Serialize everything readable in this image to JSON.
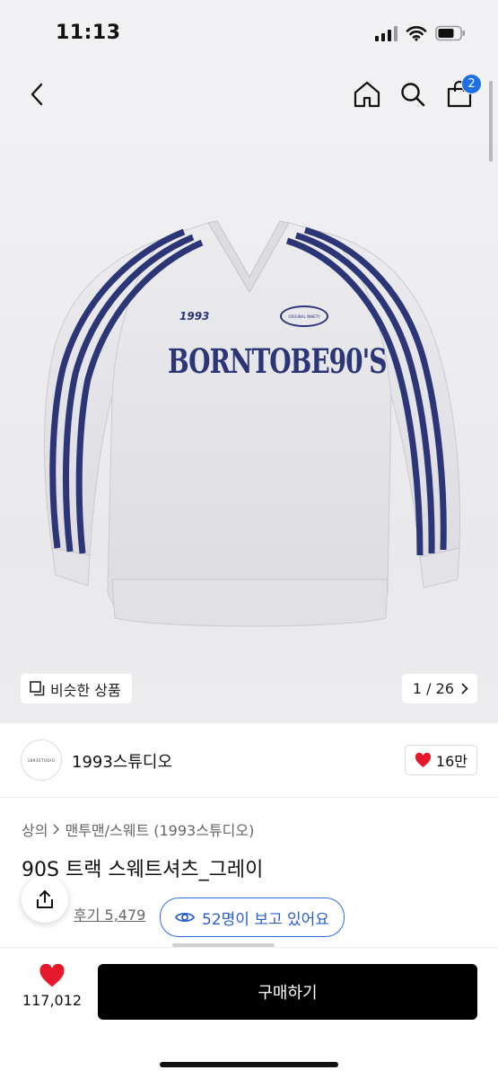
{
  "status_bar": {
    "time": "11:13"
  },
  "nav": {
    "cart_count": "2",
    "back_icon": "chevron-left-icon",
    "home_icon": "home-icon",
    "search_icon": "search-icon",
    "cart_icon": "shopping-bag-icon"
  },
  "gallery": {
    "similar_label": "비슷한 상품",
    "page_counter": "1 / 26",
    "print_text": "BORNTOBE90'S",
    "chest_logo": "1993",
    "badge_text": "ORIGINAL NINETY",
    "colors": {
      "body": "#e6e6e9",
      "stripe": "#2c3575"
    }
  },
  "brand": {
    "name": "1993스튜디오",
    "logo_text": "1993STUDIO",
    "likes": "16만"
  },
  "product": {
    "breadcrumb": [
      "상의",
      "맨투맨/스웨트 (1993스튜디오)"
    ],
    "title": "90S 트랙 스웨트셔츠_그레이",
    "review_text": "후기 5,479",
    "viewers_text": "52명이 보고 있어요"
  },
  "bottom": {
    "favorite_count": "117,012",
    "buy_label": "구매하기"
  },
  "colors": {
    "accent_blue": "#1f6fe5",
    "heart_red": "#e5192b",
    "buy_bg": "#000000"
  }
}
